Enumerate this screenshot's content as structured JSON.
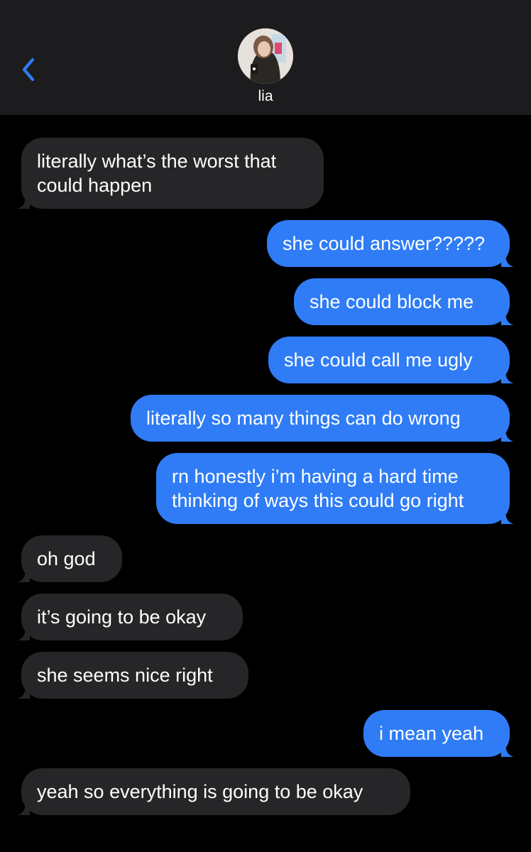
{
  "header": {
    "contact_name": "lia"
  },
  "messages": [
    {
      "direction": "incoming",
      "text_lines": [
        "literally what’s the worst that",
        "could happen"
      ]
    },
    {
      "direction": "outgoing",
      "text_lines": [
        "she could answer?????"
      ]
    },
    {
      "direction": "outgoing",
      "text_lines": [
        "she could block me"
      ]
    },
    {
      "direction": "outgoing",
      "text_lines": [
        "she could call me ugly"
      ]
    },
    {
      "direction": "outgoing",
      "text_lines": [
        "literally so many things can do wrong"
      ]
    },
    {
      "direction": "outgoing",
      "text_lines": [
        "rn honestly i’m having a hard time",
        "thinking of ways this could go right"
      ]
    },
    {
      "direction": "incoming",
      "text_lines": [
        "oh god"
      ]
    },
    {
      "direction": "incoming",
      "text_lines": [
        "it’s going to be okay"
      ]
    },
    {
      "direction": "incoming",
      "text_lines": [
        "she seems nice right"
      ]
    },
    {
      "direction": "outgoing",
      "text_lines": [
        "i mean yeah"
      ]
    },
    {
      "direction": "incoming",
      "text_lines": [
        "yeah so everything is going to be okay"
      ]
    }
  ],
  "colors": {
    "outgoing_bubble": "#2f7cf6",
    "incoming_bubble": "#262628",
    "header_bg": "#1c1c1e",
    "accent": "#2f7cf6"
  },
  "icons": {
    "back": "chevron-left-icon",
    "avatar": "contact-photo"
  }
}
